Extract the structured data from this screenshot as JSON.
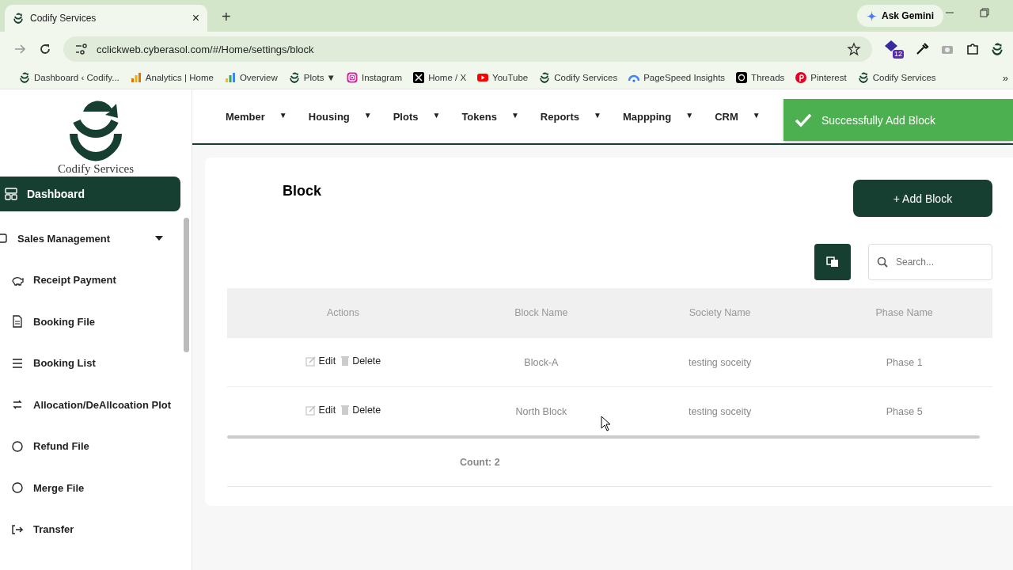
{
  "browser": {
    "tab": {
      "title": "Codify Services",
      "close": "×"
    },
    "new_tab": "+",
    "ask_gemini": "Ask Gemini",
    "url": "cclickweb.cyberasol.com/#/Home/settings/block",
    "extension_badge": "12",
    "bookmarks": [
      {
        "label": "Dashboard ‹ Codify...",
        "kind": "logo"
      },
      {
        "label": "Analytics | Home",
        "kind": "analytics"
      },
      {
        "label": "Overview",
        "kind": "overview"
      },
      {
        "label": "Plots ▼",
        "kind": "logo"
      },
      {
        "label": "Instagram",
        "kind": "instagram"
      },
      {
        "label": "Home / X",
        "kind": "x"
      },
      {
        "label": "YouTube",
        "kind": "youtube"
      },
      {
        "label": "Codify Services",
        "kind": "logo"
      },
      {
        "label": "PageSpeed Insights",
        "kind": "pagespeed"
      },
      {
        "label": "Threads",
        "kind": "threads"
      },
      {
        "label": "Pinterest",
        "kind": "pinterest"
      },
      {
        "label": "Codify Services",
        "kind": "logo"
      }
    ],
    "more": "»"
  },
  "sidebar": {
    "logo_text": "Codify Services",
    "items": [
      {
        "label": "Dashboard",
        "kind": "dashboard",
        "selected": true
      },
      {
        "label": "Sales Management",
        "kind": "group",
        "selected": false,
        "expanded": true
      },
      {
        "label": "Receipt Payment",
        "kind": "payment",
        "selected": false
      },
      {
        "label": "Booking File",
        "kind": "file",
        "selected": false
      },
      {
        "label": "Booking List",
        "kind": "list",
        "selected": false
      },
      {
        "label": "Allocation/DeAllcoation Plot",
        "kind": "swap",
        "selected": false
      },
      {
        "label": "Refund File",
        "kind": "circle",
        "selected": false
      },
      {
        "label": "Merge File",
        "kind": "circle",
        "selected": false
      },
      {
        "label": "Transfer",
        "kind": "transfer",
        "selected": false
      }
    ]
  },
  "top_menu": [
    {
      "label": "Member",
      "caret": "▼"
    },
    {
      "label": "Housing",
      "caret": "▼"
    },
    {
      "label": "Plots",
      "caret": "▼"
    },
    {
      "label": "Tokens",
      "caret": "▼"
    },
    {
      "label": "Reports",
      "caret": "▼"
    },
    {
      "label": "Mappping",
      "caret": "▼"
    },
    {
      "label": "CRM",
      "caret": "▼"
    }
  ],
  "toast": {
    "message": "Successfully Add Block"
  },
  "page": {
    "title": "Block",
    "add_button": "+ Add Block",
    "search": {
      "placeholder": "Search..."
    },
    "table": {
      "actions_column": "Actions",
      "columns": [
        "Block Name",
        "Society Name",
        "Phase Name"
      ],
      "rows": [
        {
          "edit": "Edit",
          "delete": "Delete",
          "cells": [
            "Block-A",
            "testing soceity",
            "Phase 1"
          ]
        },
        {
          "edit": "Edit",
          "delete": "Delete",
          "cells": [
            "North Block",
            "testing soceity",
            "Phase 5"
          ]
        }
      ],
      "count": "Count: 2"
    }
  }
}
